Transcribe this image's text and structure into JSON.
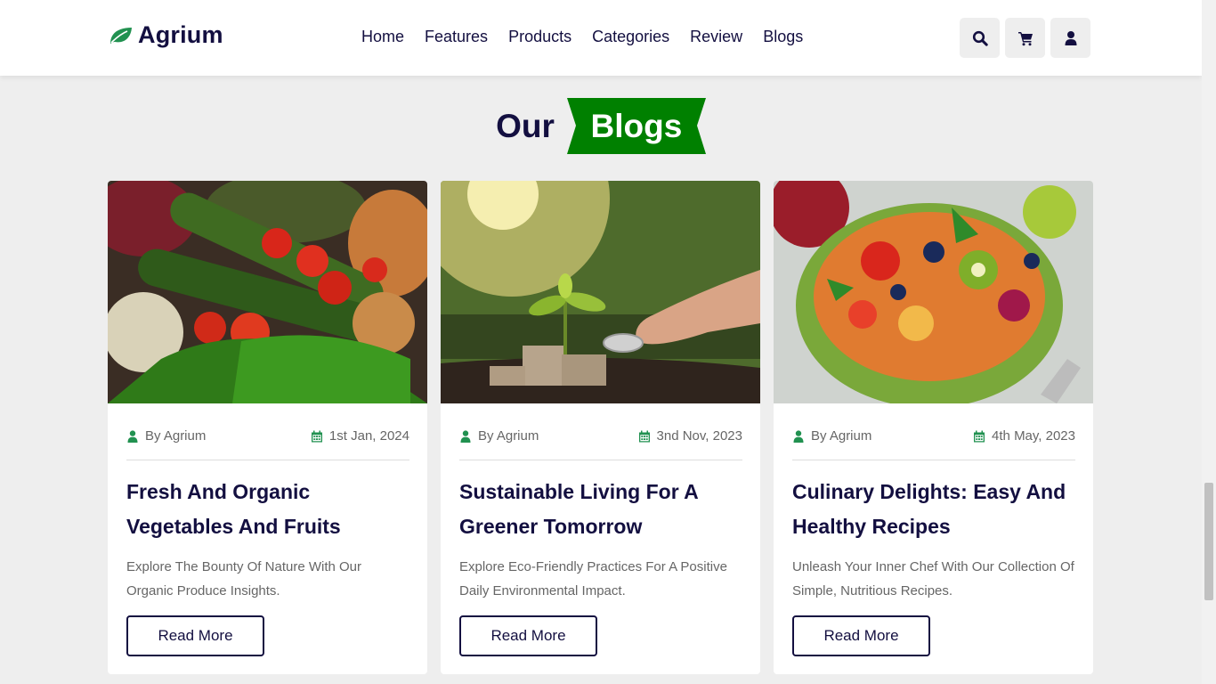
{
  "header": {
    "logo_text": "Agrium",
    "nav": [
      "Home",
      "Features",
      "Products",
      "Categories",
      "Review",
      "Blogs"
    ],
    "icons": [
      "search-icon",
      "cart-icon",
      "user-icon"
    ]
  },
  "section": {
    "heading_prefix": "Our",
    "heading_highlight": "Blogs"
  },
  "blogs": [
    {
      "author": "By Agrium",
      "date": "1st Jan, 2024",
      "title": "Fresh And Organic Vegetables And Fruits",
      "description": "Explore The Bounty Of Nature With Our Organic Produce Insights.",
      "button": "Read More",
      "image": "vegetables-photo"
    },
    {
      "author": "By Agrium",
      "date": "3nd Nov, 2023",
      "title": "Sustainable Living For A Greener Tomorrow",
      "description": "Explore Eco-Friendly Practices For A Positive Daily Environmental Impact.",
      "button": "Read More",
      "image": "sprout-coins-photo"
    },
    {
      "author": "By Agrium",
      "date": "4th May, 2023",
      "title": "Culinary Delights: Easy And Healthy Recipes",
      "description": "Unleash Your Inner Chef With Our Collection Of Simple, Nutritious Recipes.",
      "button": "Read More",
      "image": "fruit-salad-photo"
    }
  ],
  "colors": {
    "brand": "#130f40",
    "accent": "#008000",
    "icon_green": "#219150",
    "background": "#eeeeee"
  }
}
